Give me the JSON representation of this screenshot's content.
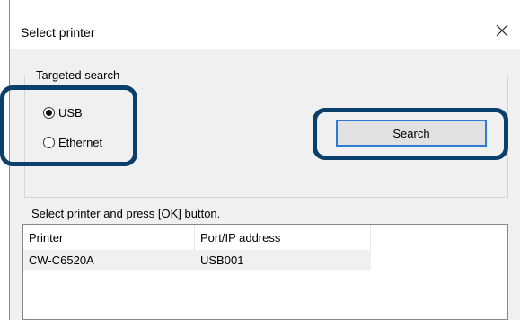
{
  "dialog": {
    "title": "Select printer"
  },
  "group": {
    "legend": "Targeted search",
    "options": [
      {
        "label": "USB",
        "selected": true
      },
      {
        "label": "Ethernet",
        "selected": false
      }
    ]
  },
  "search_button": {
    "label": "Search"
  },
  "instruction": "Select printer and press [OK] button.",
  "list": {
    "columns": [
      "Printer",
      "Port/IP address"
    ],
    "rows": [
      {
        "printer": "CW-C6520A",
        "port": "USB001"
      }
    ]
  },
  "colors": {
    "highlight": "#0b3f6b",
    "button_focus": "#2d7cd4",
    "client_bg": "#f0f0f0"
  }
}
